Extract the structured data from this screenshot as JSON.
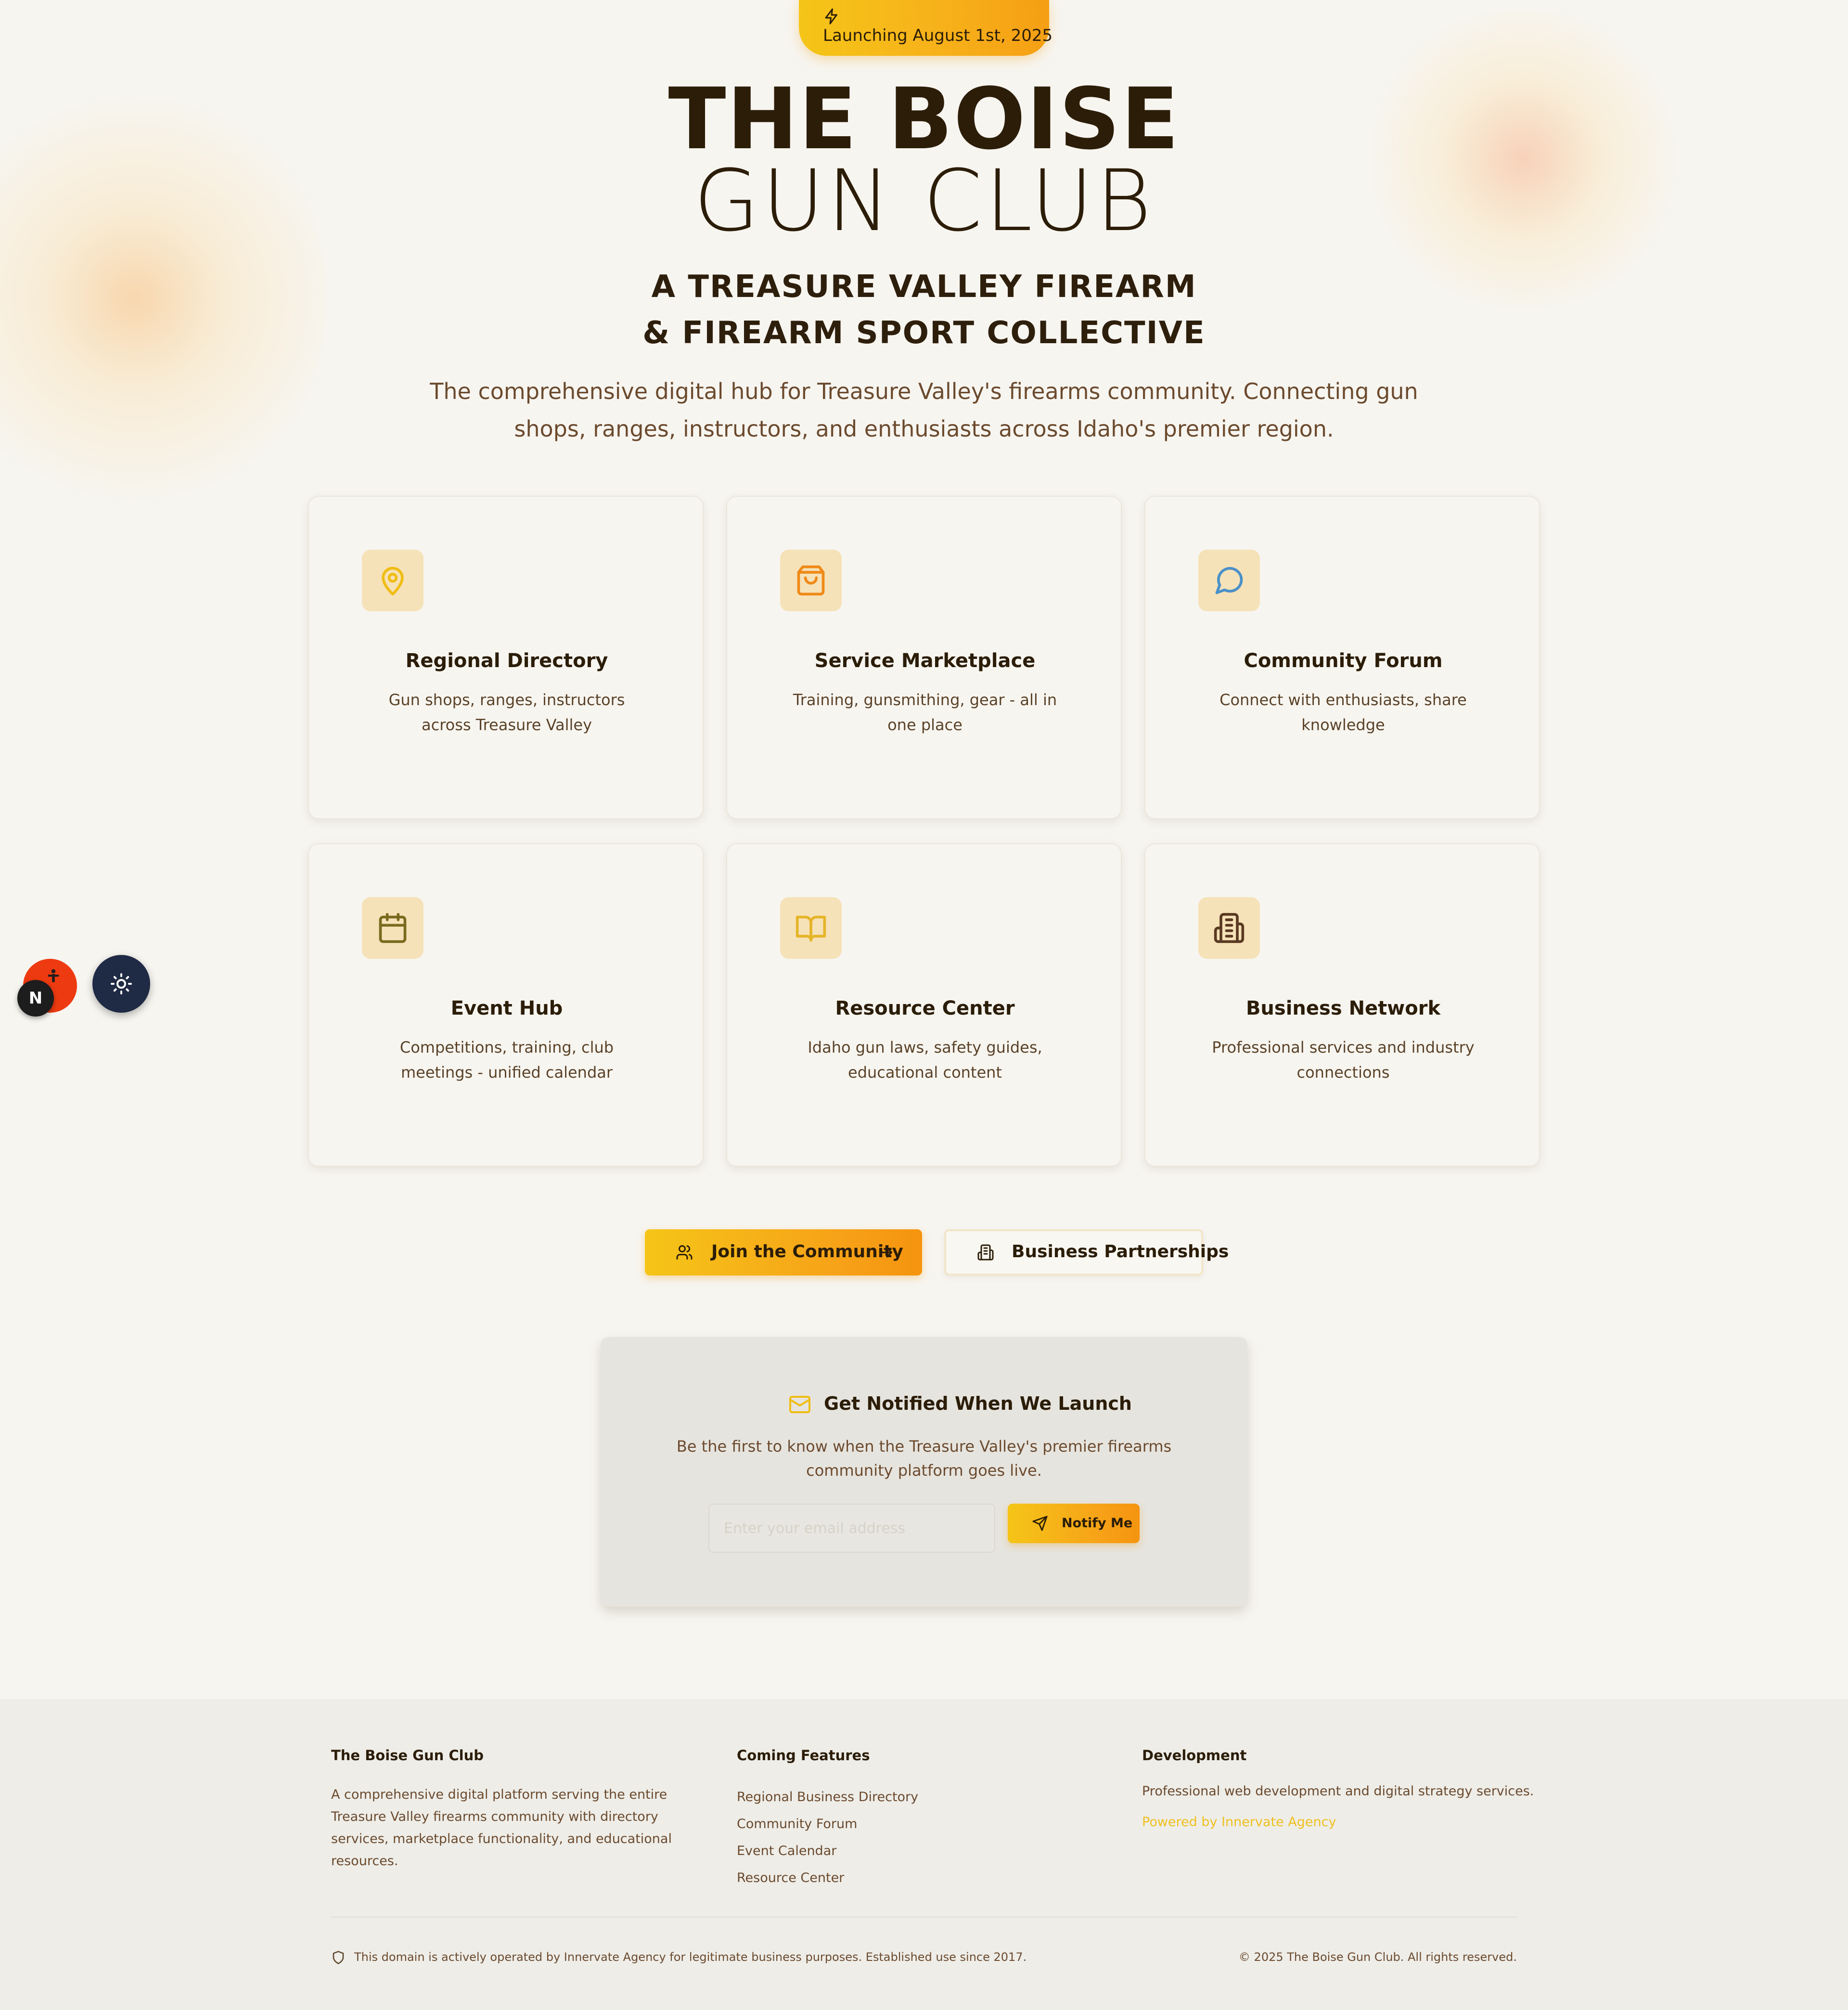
{
  "colors": {
    "background": "#f7f5f0",
    "accent_start": "#f5c518",
    "accent_end": "#f5940f",
    "text_dark": "#2b1d08",
    "text_muted": "#6b4a2e",
    "link": "#f0c020",
    "theme_fab": "#1f2a44",
    "accessibility_fab": "#ee3a10"
  },
  "hero": {
    "badge_icon": "bolt-icon",
    "badge": "Launching August 1st, 2025",
    "title_line1": "THE BOISE",
    "title_line2": "GUN CLUB",
    "subtitle_line1": "A TREASURE VALLEY FIREARM",
    "subtitle_line2": "& FIREARM SPORT COLLECTIVE",
    "description": "The comprehensive digital hub for Treasure Valley's firearms community. Connecting gun shops, ranges, instructors, and enthusiasts across Idaho's premier region."
  },
  "features": [
    {
      "icon": "map-pin-icon",
      "title": "Regional Directory",
      "description": "Gun shops, ranges, instructors across Treasure Valley"
    },
    {
      "icon": "shopping-bag-icon",
      "title": "Service Marketplace",
      "description": "Training, gunsmithing, gear - all in one place"
    },
    {
      "icon": "message-circle-icon",
      "title": "Community Forum",
      "description": "Connect with enthusiasts, share knowledge"
    },
    {
      "icon": "calendar-icon",
      "title": "Event Hub",
      "description": "Competitions, training, club meetings - unified calendar"
    },
    {
      "icon": "book-open-icon",
      "title": "Resource Center",
      "description": "Idaho gun laws, safety guides, educational content"
    },
    {
      "icon": "building-icon",
      "title": "Business Network",
      "description": "Professional services and industry connections"
    }
  ],
  "cta": {
    "join_label": "Join the Community",
    "business_label": "Business Partnerships"
  },
  "notify": {
    "title": "Get Notified When We Launch",
    "description": "Be the first to know when the Treasure Valley's premier firearms community platform goes live.",
    "email_placeholder": "Enter your email address",
    "email_value": "",
    "button_label": "Notify Me"
  },
  "widgets": {
    "accessibility_icon": "accessibility-person-icon",
    "next_badge": "N",
    "theme_icon": "sun-icon"
  },
  "footer": {
    "about_heading": "The Boise Gun Club",
    "about_text": "A comprehensive digital platform serving the entire Treasure Valley firearms community with directory services, marketplace functionality, and educational resources.",
    "features_heading": "Coming Features",
    "features_links": [
      "Regional Business Directory",
      "Community Forum",
      "Event Calendar",
      "Resource Center"
    ],
    "dev_heading": "Development",
    "dev_text": "Professional web development and digital strategy services.",
    "powered_by": "Powered by Innervate Agency",
    "legal": "This domain is actively operated by Innervate Agency for legitimate business purposes. Established use since 2017.",
    "copyright": "© 2025 The Boise Gun Club. All rights reserved."
  }
}
